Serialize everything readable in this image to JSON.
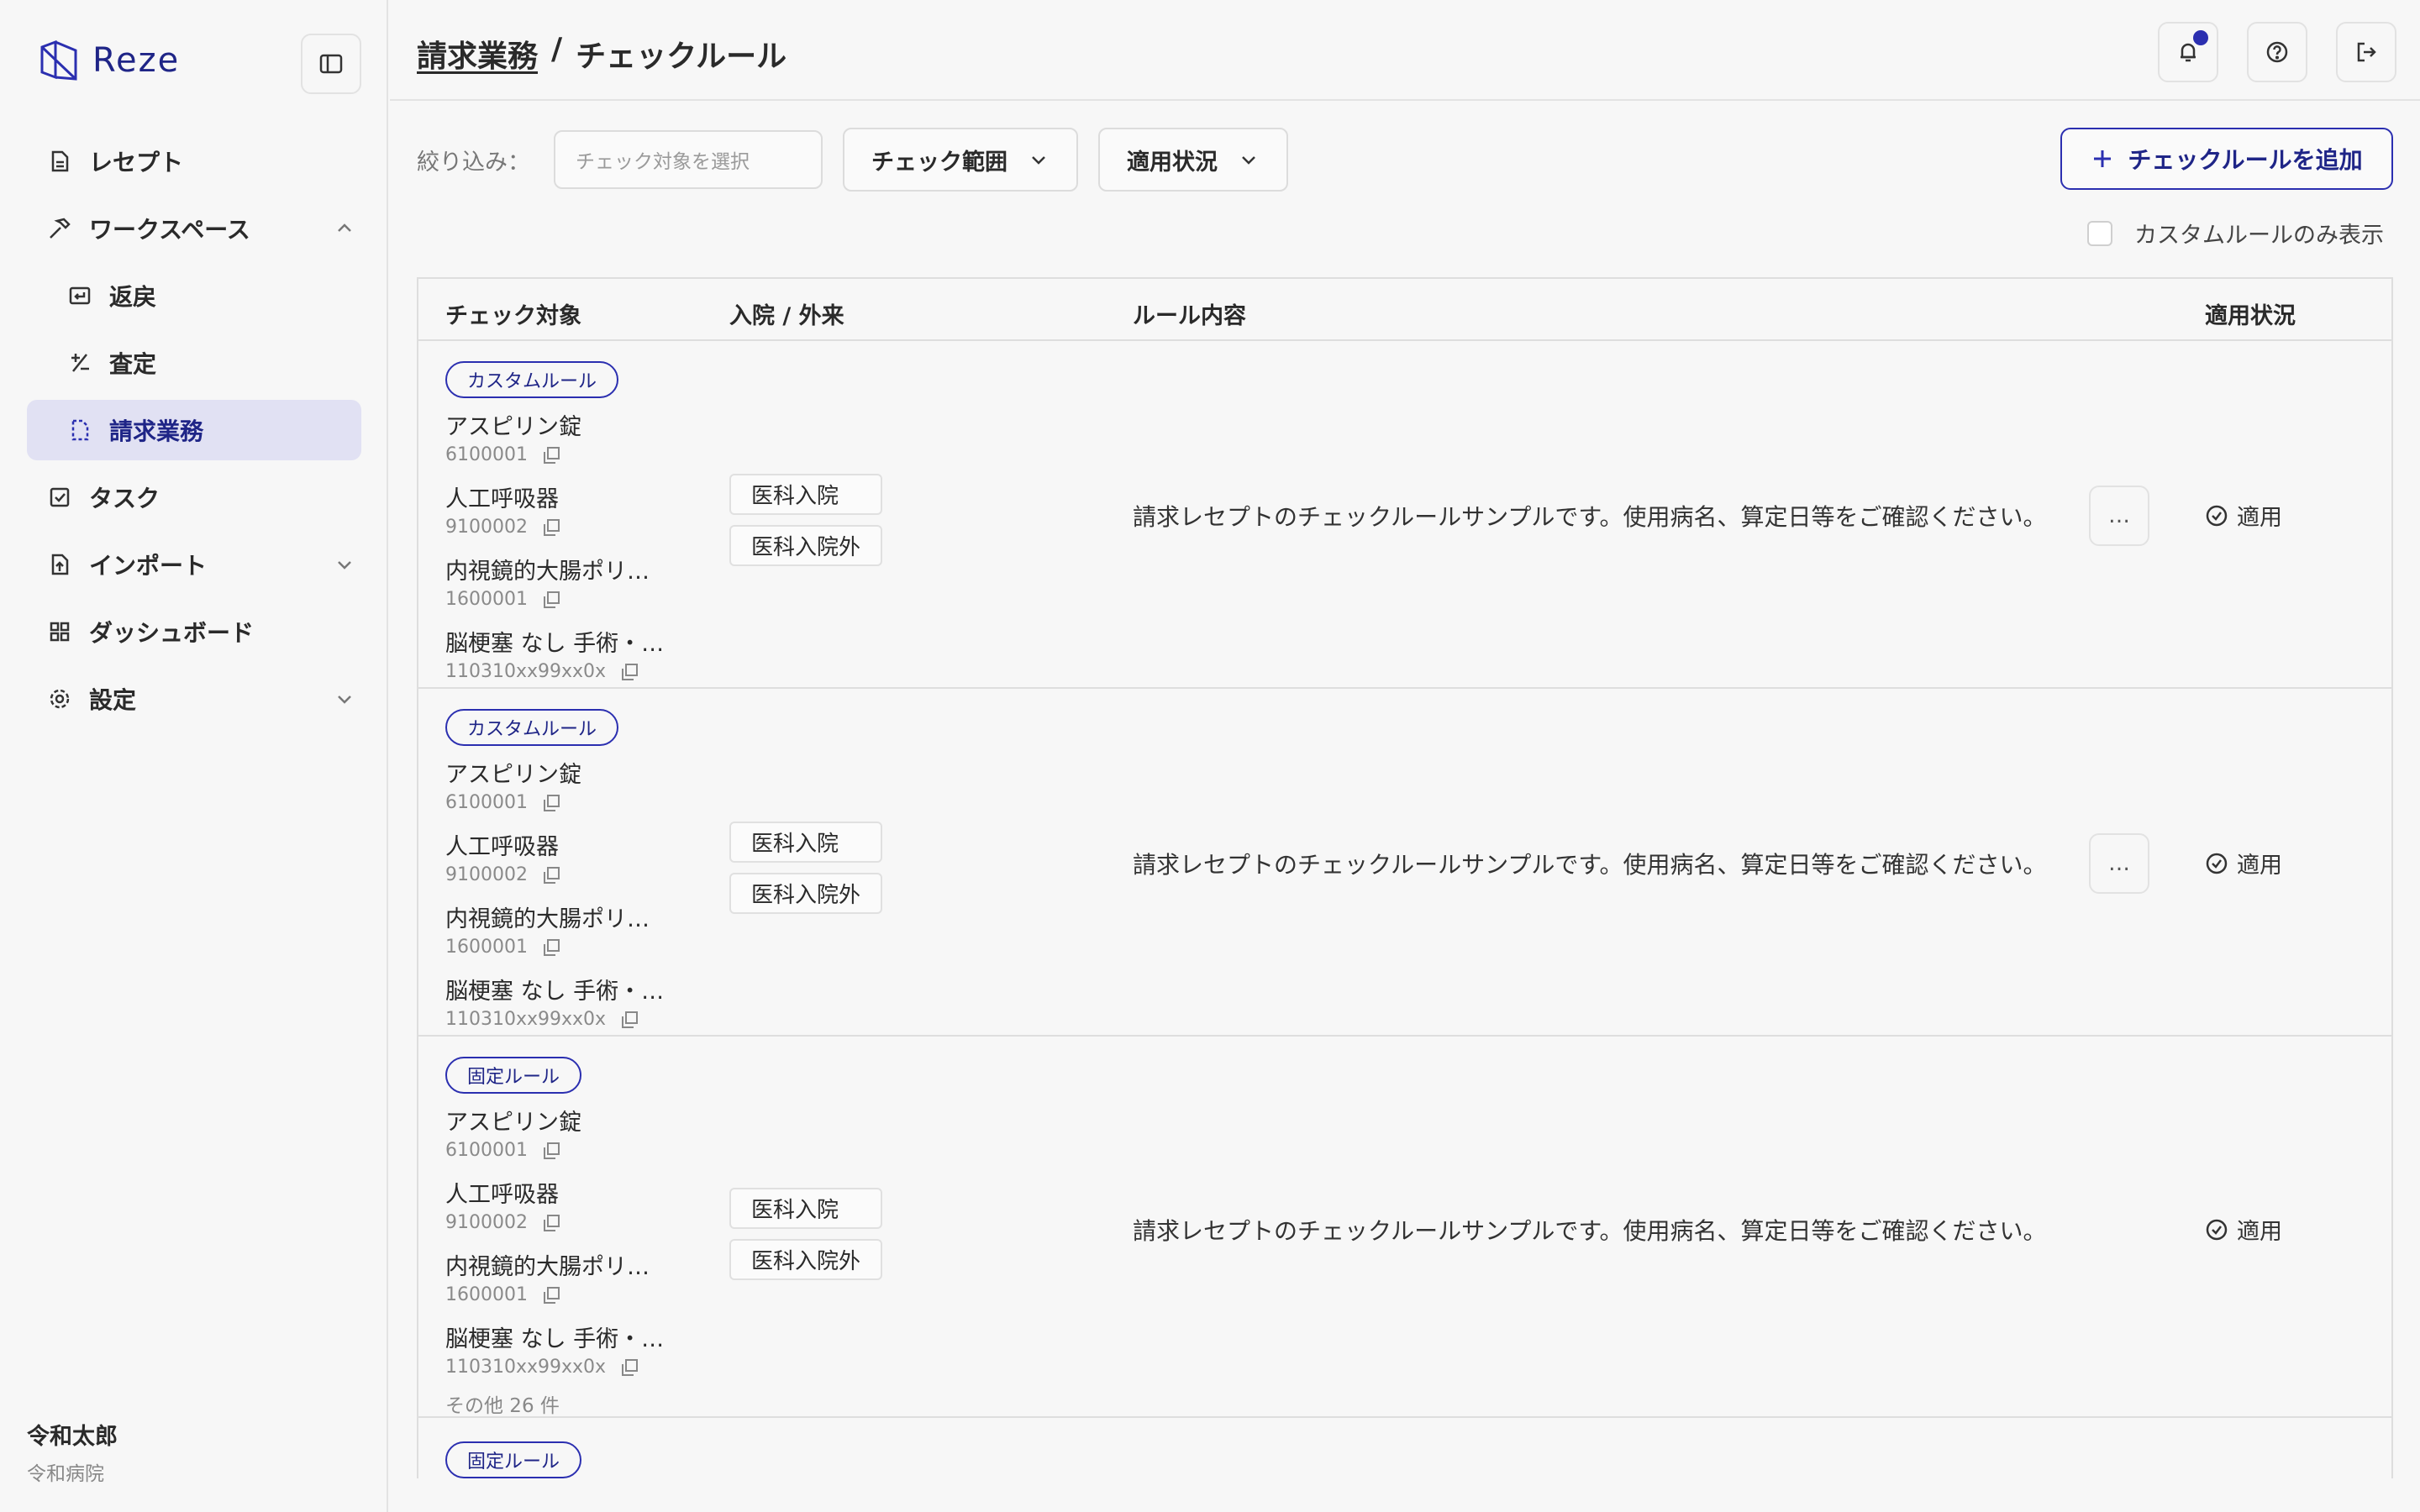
{
  "app": {
    "logo_text": "Reze"
  },
  "sidebar": {
    "items": [
      {
        "label": "レセプト",
        "icon": "document-icon"
      },
      {
        "label": "ワークスペース",
        "icon": "hammer-icon"
      },
      {
        "label": "返戻",
        "icon": "return-icon"
      },
      {
        "label": "査定",
        "icon": "plus-minus-icon"
      },
      {
        "label": "請求業務",
        "icon": "dashed-document-icon"
      },
      {
        "label": "タスク",
        "icon": "checkbox-icon"
      },
      {
        "label": "インポート",
        "icon": "file-import-icon"
      },
      {
        "label": "ダッシュボード",
        "icon": "grid-icon"
      },
      {
        "label": "設定",
        "icon": "gear-icon"
      }
    ],
    "user": {
      "name": "令和太郎",
      "org": "令和病院"
    }
  },
  "header": {
    "breadcrumb_parent": "請求業務",
    "breadcrumb_sep": "/",
    "breadcrumb_current": "チェックルール"
  },
  "filters": {
    "label": "絞り込み：",
    "target_placeholder": "チェック対象を選択",
    "scope_label": "チェック範囲",
    "status_label": "適用状況",
    "add_button": "チェックルールを追加",
    "custom_only_label": "カスタムルールのみ表示"
  },
  "table": {
    "headers": {
      "target": "チェック対象",
      "inout": "入院 / 外来",
      "rule": "ルール内容",
      "status": "適用状況"
    },
    "rows": [
      {
        "tag": "カスタムルール",
        "items": [
          {
            "name": "アスピリン錠",
            "code": "6100001"
          },
          {
            "name": "人工呼吸器",
            "code": "9100002"
          },
          {
            "name": "内視鏡的大腸ポリ…",
            "code": "1600001"
          },
          {
            "name": "脳梗塞 なし 手術・…",
            "code": "110310xx99xx0x"
          }
        ],
        "badges": [
          "医科入院",
          "医科入院外"
        ],
        "rule": "請求レセプトのチェックルールサンプルです。使用病名、算定日等をご確認ください。",
        "more_button": "…",
        "status": "適用"
      },
      {
        "tag": "カスタムルール",
        "items": [
          {
            "name": "アスピリン錠",
            "code": "6100001"
          },
          {
            "name": "人工呼吸器",
            "code": "9100002"
          },
          {
            "name": "内視鏡的大腸ポリ…",
            "code": "1600001"
          },
          {
            "name": "脳梗塞 なし 手術・…",
            "code": "110310xx99xx0x"
          }
        ],
        "badges": [
          "医科入院",
          "医科入院外"
        ],
        "rule": "請求レセプトのチェックルールサンプルです。使用病名、算定日等をご確認ください。",
        "more_button": "…",
        "status": "適用"
      },
      {
        "tag": "固定ルール",
        "items": [
          {
            "name": "アスピリン錠",
            "code": "6100001"
          },
          {
            "name": "人工呼吸器",
            "code": "9100002"
          },
          {
            "name": "内視鏡的大腸ポリ…",
            "code": "1600001"
          },
          {
            "name": "脳梗塞 なし 手術・…",
            "code": "110310xx99xx0x"
          }
        ],
        "more_items": "その他 26 件",
        "badges": [
          "医科入院",
          "医科入院外"
        ],
        "rule": "請求レセプトのチェックルールサンプルです。使用病名、算定日等をご確認ください。",
        "status": "適用"
      },
      {
        "tag": "固定ルール"
      }
    ]
  },
  "colors": {
    "accent": "#2b2fb0",
    "active_bg": "#e1e1f3"
  }
}
